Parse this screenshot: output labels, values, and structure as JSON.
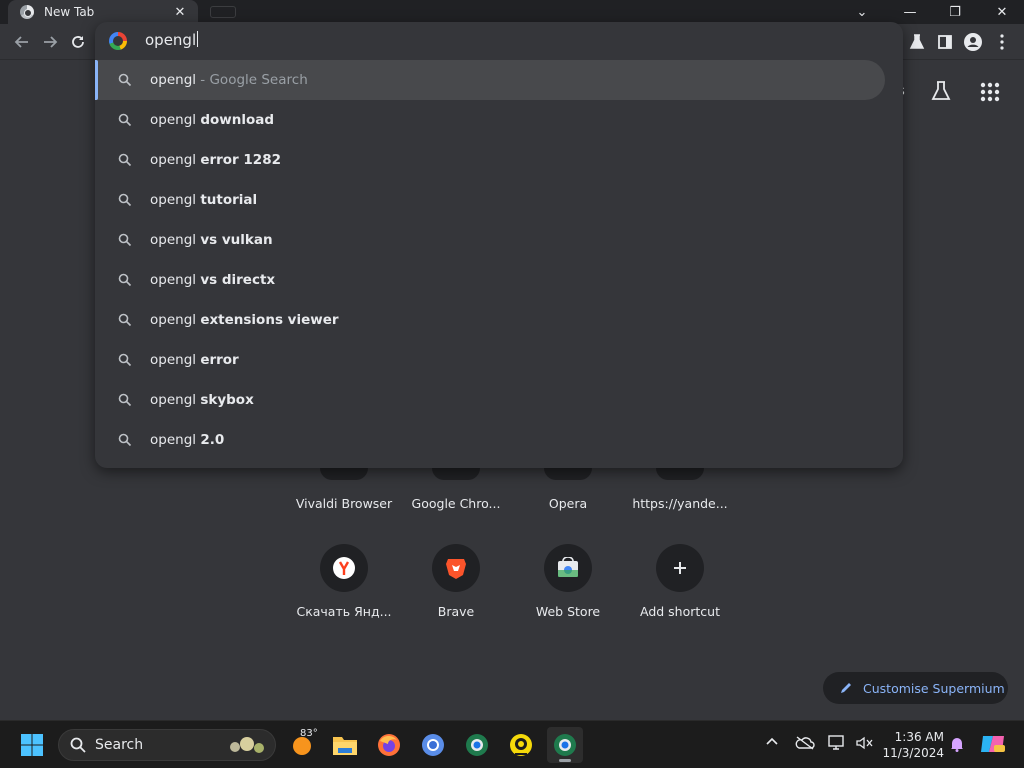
{
  "tab": {
    "title": "New Tab",
    "close": "✕"
  },
  "window": {
    "dropdown": "⌄",
    "minimize": "—",
    "restore": "❐",
    "close": "✕"
  },
  "omnibox": {
    "query": "opengl",
    "suggestions": [
      {
        "prefix": "opengl",
        "bold": "",
        "suffix": " - Google Search"
      },
      {
        "prefix": "opengl ",
        "bold": "download",
        "suffix": ""
      },
      {
        "prefix": "opengl ",
        "bold": "error 1282",
        "suffix": ""
      },
      {
        "prefix": "opengl ",
        "bold": "tutorial",
        "suffix": ""
      },
      {
        "prefix": "opengl ",
        "bold": "vs vulkan",
        "suffix": ""
      },
      {
        "prefix": "opengl ",
        "bold": "vs directx",
        "suffix": ""
      },
      {
        "prefix": "opengl ",
        "bold": "extensions viewer",
        "suffix": ""
      },
      {
        "prefix": "opengl ",
        "bold": "error",
        "suffix": ""
      },
      {
        "prefix": "opengl ",
        "bold": "skybox",
        "suffix": ""
      },
      {
        "prefix": "opengl ",
        "bold": "2.0",
        "suffix": ""
      }
    ]
  },
  "ntp": {
    "header_partial": "s",
    "shortcuts_row1": [
      "Vivaldi Browser",
      "Google Chro...",
      "Opera",
      "https://yande..."
    ],
    "shortcuts_row2": [
      "Скачать Янд...",
      "Brave",
      "Web Store",
      "Add shortcut"
    ],
    "customise": "Customise Supermium"
  },
  "taskbar": {
    "search_label": "Search",
    "weather_temp": "83°",
    "time": "1:36 AM",
    "date": "11/3/2024"
  },
  "colors": {
    "accent": "#8ab4f8",
    "background": "#35363a",
    "titlebar": "#202124",
    "taskbar": "#1c1c1c"
  }
}
